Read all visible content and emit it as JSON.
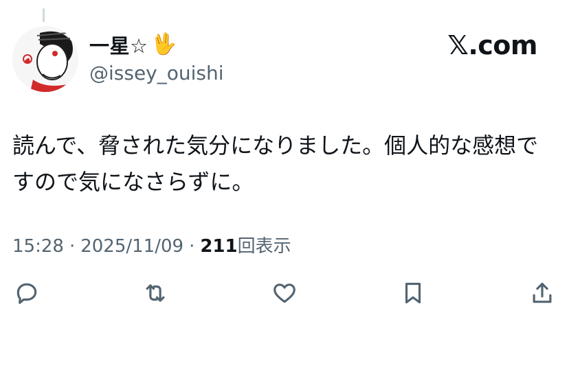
{
  "tweet": {
    "author": {
      "display_name": "一星☆",
      "emoji": "🖖",
      "handle": "@issey_ouishi"
    },
    "watermark": "𝕏.com",
    "text": "読んで、脅された気分になりました。個人的な感想ですので気になさらずに。",
    "meta": {
      "time": "15:28",
      "date": "2025/11/09",
      "views_count": "211",
      "views_label": "回表示",
      "separator": "·"
    },
    "actions": [
      "reply-icon",
      "retweet-icon",
      "like-icon",
      "bookmark-icon",
      "share-icon"
    ],
    "colors": {
      "text_primary": "#0f1419",
      "text_secondary": "#536471",
      "thread_line": "#cfd9de",
      "avatar_accent": "#d12a2a"
    }
  }
}
